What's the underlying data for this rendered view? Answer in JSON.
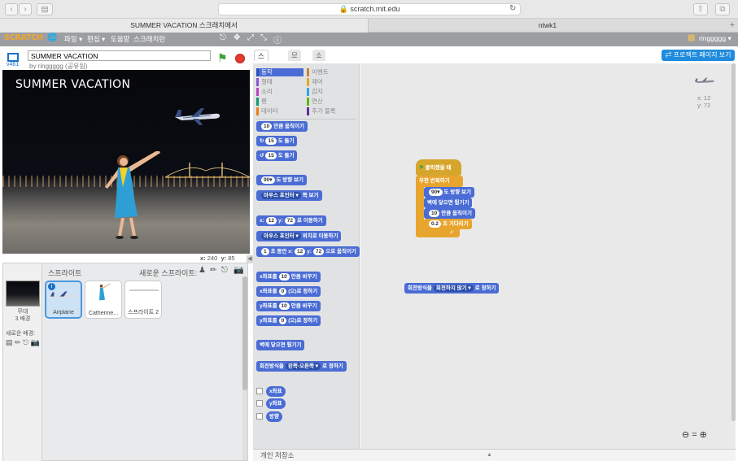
{
  "browser": {
    "url": "scratch.mit.edu",
    "tabs": [
      {
        "label": "SUMMER VACATION 스크래치에서"
      },
      {
        "label": "ntwk1"
      }
    ]
  },
  "menubar": {
    "logo": "SCRATCH",
    "items": [
      "파일 ▾",
      "편집 ▾",
      "도움말",
      "스크래치란"
    ],
    "user": "ringgggg ▾"
  },
  "project": {
    "title": "SUMMER VACATION",
    "byline": "by ringgggg (공유됨)",
    "mode_label": "v461"
  },
  "stage": {
    "title_text": "SUMMER VACATION",
    "mouse_x_label": "x:",
    "mouse_x": "240",
    "mouse_y_label": "y:",
    "mouse_y": "85"
  },
  "sprites": {
    "header": "스프라이트",
    "new_sprite": "새로운 스프라이트:",
    "items": [
      {
        "name": "Airplane",
        "selected": true
      },
      {
        "name": "Catherine..."
      },
      {
        "name": "스프라이트 2"
      }
    ],
    "stage_caption": "무대",
    "stage_backdrops": "3 배경",
    "new_backdrop": "새로운 배경:"
  },
  "tabs": [
    {
      "label": "스크립트",
      "active": true
    },
    {
      "label": "모양"
    },
    {
      "label": "소리"
    }
  ],
  "project_page_button": "프로젝트 페이지 보기",
  "categories": [
    {
      "label": "동작",
      "color": "#4a6cd4",
      "active": true
    },
    {
      "label": "이벤트",
      "color": "#c88330"
    },
    {
      "label": "형태",
      "color": "#8a55d7"
    },
    {
      "label": "제어",
      "color": "#e1a91a"
    },
    {
      "label": "소리",
      "color": "#bb42c3"
    },
    {
      "label": "감지",
      "color": "#2ca5e2"
    },
    {
      "label": "펜",
      "color": "#0e9a6c"
    },
    {
      "label": "연산",
      "color": "#5cb712"
    },
    {
      "label": "데이터",
      "color": "#ee7d16"
    },
    {
      "label": "추가 블록",
      "color": "#632d99"
    }
  ],
  "palette_blocks": {
    "move": {
      "pre": "",
      "num": "10",
      "post": "만큼 움직이기"
    },
    "turn_cw": {
      "pre": "↻",
      "num": "15",
      "post": "도 돌기"
    },
    "turn_ccw": {
      "pre": "↺",
      "num": "15",
      "post": "도 돌기"
    },
    "point_dir": {
      "pre": "",
      "num": "90▾",
      "post": "도 방향 보기"
    },
    "point_toward": {
      "pre": "",
      "num": "마우스 포인터 ▾",
      "post": "쪽 보기"
    },
    "goto_xy": {
      "pre": "x:",
      "num": "12",
      "mid": "y:",
      "num2": "72",
      "post": "로 이동하기"
    },
    "goto_target": {
      "pre": "",
      "num": "마우스 포인터 ▾",
      "post": "위치로 이동하기"
    },
    "glide": {
      "pre": "",
      "num": "1",
      "mid": "초 동안 x:",
      "num2": "12",
      "mid2": "y:",
      "num3": "72",
      "post": "으로 움직이기"
    },
    "change_x": {
      "pre": "x좌표를",
      "num": "10",
      "post": "만큼 바꾸기"
    },
    "set_x": {
      "pre": "x좌표를",
      "num": "0",
      "post": "(으)로 정하기"
    },
    "change_y": {
      "pre": "y좌표를",
      "num": "10",
      "post": "만큼 바꾸기"
    },
    "set_y": {
      "pre": "y좌표를",
      "num": "0",
      "post": "(으)로 정하기"
    },
    "bounce": {
      "label": "벽에 닿으면 튕기기"
    },
    "rotation_style": {
      "pre": "회전방식을",
      "num": "왼쪽-오른쪽 ▾",
      "post": "로 정하기"
    },
    "rep_x": {
      "label": "x좌표"
    },
    "rep_y": {
      "label": "y좌표"
    },
    "rep_dir": {
      "label": "방향"
    }
  },
  "script": {
    "hat": "클릭했을 때",
    "forever": "무한 반복하기",
    "point_dir": {
      "num": "90▾",
      "post": "도 방향 보기"
    },
    "bounce": "벽에 닿으면 튕기기",
    "move": {
      "num": "10",
      "post": "만큼 움직이기"
    },
    "wait": {
      "num": "0.2",
      "post": "초 기다리기"
    },
    "loose_block": {
      "pre": "회전방식을",
      "num": "회전하지 않기 ▾",
      "post": "로 정하기"
    },
    "sprite_xy": {
      "x": "x: 12",
      "y": "y: 72"
    }
  },
  "storage_label": "개인 저장소",
  "colors": {
    "motion": "#4a6cd4",
    "events": "#d6a52b",
    "control": "#e8a52e",
    "menubar": "#9c9ea2"
  }
}
